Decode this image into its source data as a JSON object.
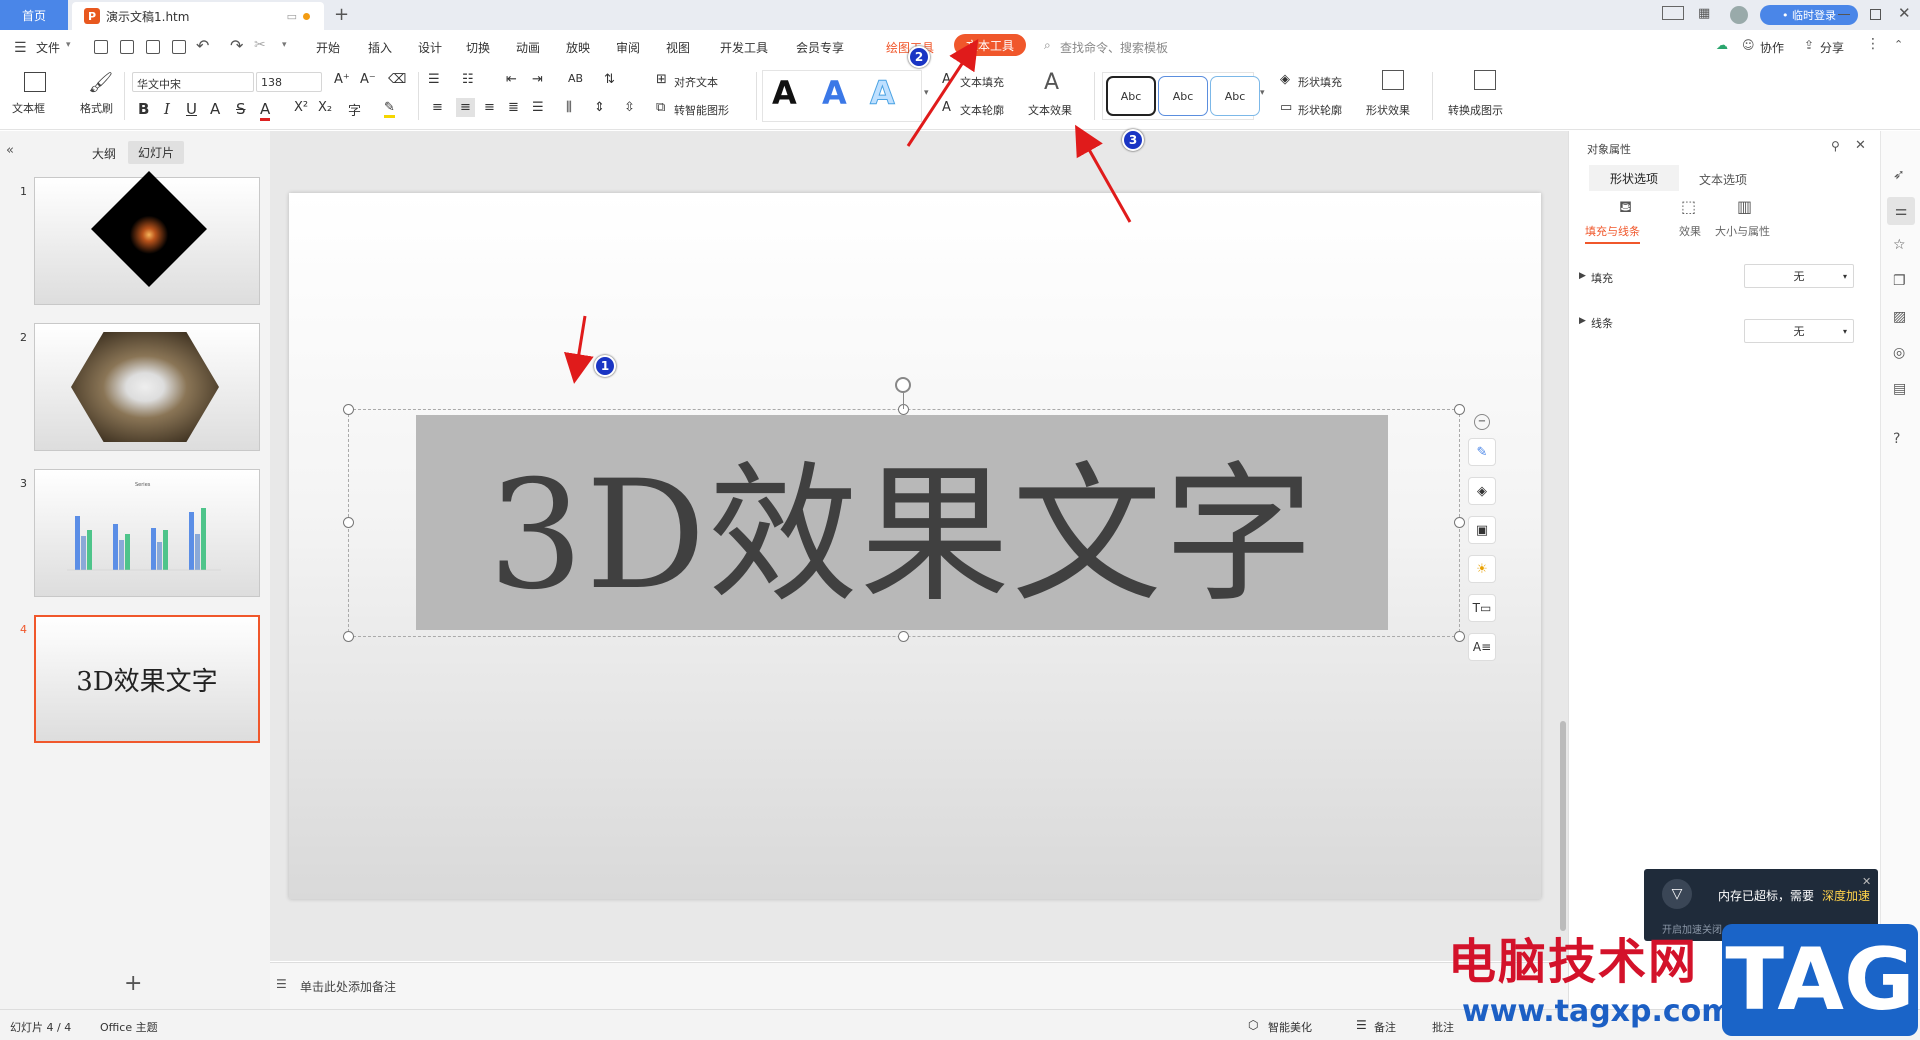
{
  "titlebar": {
    "home_tab": "首页",
    "doc_tab": "演示文稿1.htm",
    "login": "• 临时登录"
  },
  "menu": {
    "file": "文件",
    "tabs": [
      "开始",
      "插入",
      "设计",
      "切换",
      "动画",
      "放映",
      "审阅",
      "视图",
      "开发工具",
      "会员专享"
    ],
    "drawing_tools": "绘图工具",
    "text_tools": "文本工具",
    "search_placeholder": "查找命令、搜索模板",
    "collab": "协作",
    "share": "分享"
  },
  "ribbon": {
    "textbox": "文本框",
    "format_painter": "格式刷",
    "font": "华文中宋",
    "font_size": "138",
    "align_text": "对齐文本",
    "smart_shape": "转智能图形",
    "text_fill": "文本填充",
    "text_outline": "文本轮廓",
    "text_effect": "文本效果",
    "abc": [
      "Abc",
      "Abc",
      "Abc"
    ],
    "shape_fill": "形状填充",
    "shape_outline": "形状轮廓",
    "shape_effect": "形状效果",
    "convert": "转换成图示"
  },
  "leftpanel": {
    "outline_tab": "大纲",
    "slides_tab": "幻灯片",
    "slide_numbers": [
      "1",
      "2",
      "3",
      "4"
    ],
    "slide4_text": "3D效果文字",
    "chart_title": "Series"
  },
  "slide": {
    "text": "3D效果文字"
  },
  "notes": {
    "placeholder": "单击此处添加备注"
  },
  "rightpanel": {
    "title": "对象属性",
    "tab_shape": "形状选项",
    "tab_text": "文本选项",
    "sub_fill_line": "填充与线条",
    "sub_effect": "效果",
    "sub_size": "大小与属性",
    "fill_label": "填充",
    "fill_value": "无",
    "line_label": "线条",
    "line_value": "无"
  },
  "statusbar": {
    "slide_count": "幻灯片 4 / 4",
    "theme": "Office 主题",
    "beautify": "智能美化",
    "notes": "备注",
    "comment": "批注"
  },
  "popup": {
    "message": "内存已超标，需要",
    "action": "深度加速",
    "sub": "开启加速关闭"
  },
  "watermark": {
    "text": "电脑技术网",
    "url": "www.tagxp.com",
    "tag": "TAG"
  },
  "badges": [
    "1",
    "2",
    "3"
  ],
  "colors": {
    "accent": "#4a86e8",
    "text_tools_tab": "#f0572b",
    "selection": "#b8b8b8",
    "drawing_tools": "#f0572b"
  }
}
